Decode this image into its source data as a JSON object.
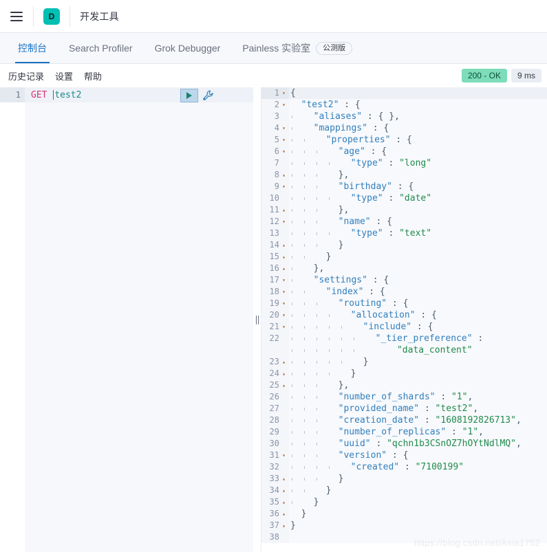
{
  "chrome": {
    "menu_icon": "hamburger-icon",
    "logo_letter": "D",
    "title": "开发工具"
  },
  "tabs": [
    {
      "label": "控制台",
      "active": true
    },
    {
      "label": "Search Profiler",
      "active": false
    },
    {
      "label": "Grok Debugger",
      "active": false
    },
    {
      "label": "Painless 实验室",
      "active": false,
      "badge": "公测版"
    }
  ],
  "console_menu": [
    {
      "label": "历史记录"
    },
    {
      "label": "设置"
    },
    {
      "label": "帮助"
    }
  ],
  "status": {
    "code_label": "200 - OK",
    "time_label": "9 ms",
    "ok_color": "#7ddcb9",
    "time_color": "#e9edf3"
  },
  "request": {
    "line_number": "1",
    "method": "GET",
    "path": "test2",
    "run_icon": "play-icon",
    "wrench_icon": "wrench-icon"
  },
  "response": {
    "lines": [
      {
        "n": "1",
        "fold": "open",
        "guides": 0,
        "text": "{",
        "hl": true
      },
      {
        "n": "2",
        "fold": "open",
        "guides": 0,
        "text": "  \"test2\" : {"
      },
      {
        "n": "3",
        "fold": "",
        "guides": 1,
        "text": "  \"aliases\" : { },"
      },
      {
        "n": "4",
        "fold": "open",
        "guides": 1,
        "text": "  \"mappings\" : {"
      },
      {
        "n": "5",
        "fold": "open",
        "guides": 2,
        "text": "  \"properties\" : {"
      },
      {
        "n": "6",
        "fold": "open",
        "guides": 3,
        "text": "  \"age\" : {"
      },
      {
        "n": "7",
        "fold": "",
        "guides": 4,
        "text": "  \"type\" : \"long\""
      },
      {
        "n": "8",
        "fold": "close",
        "guides": 3,
        "text": "  },"
      },
      {
        "n": "9",
        "fold": "open",
        "guides": 3,
        "text": "  \"birthday\" : {"
      },
      {
        "n": "10",
        "fold": "",
        "guides": 4,
        "text": "  \"type\" : \"date\""
      },
      {
        "n": "11",
        "fold": "close",
        "guides": 3,
        "text": "  },"
      },
      {
        "n": "12",
        "fold": "open",
        "guides": 3,
        "text": "  \"name\" : {"
      },
      {
        "n": "13",
        "fold": "",
        "guides": 4,
        "text": "  \"type\" : \"text\""
      },
      {
        "n": "14",
        "fold": "close",
        "guides": 3,
        "text": "  }"
      },
      {
        "n": "15",
        "fold": "close",
        "guides": 2,
        "text": "  }"
      },
      {
        "n": "16",
        "fold": "close",
        "guides": 1,
        "text": "  },"
      },
      {
        "n": "17",
        "fold": "open",
        "guides": 1,
        "text": "  \"settings\" : {"
      },
      {
        "n": "18",
        "fold": "open",
        "guides": 2,
        "text": "  \"index\" : {"
      },
      {
        "n": "19",
        "fold": "open",
        "guides": 3,
        "text": "  \"routing\" : {"
      },
      {
        "n": "20",
        "fold": "open",
        "guides": 4,
        "text": "  \"allocation\" : {"
      },
      {
        "n": "21",
        "fold": "open",
        "guides": 5,
        "text": "  \"include\" : {"
      },
      {
        "n": "22",
        "fold": "",
        "guides": 6,
        "text": "  \"_tier_preference\" :"
      },
      {
        "n": "",
        "fold": "",
        "guides": 6,
        "text": "      \"data_content\""
      },
      {
        "n": "23",
        "fold": "close",
        "guides": 5,
        "text": "  }"
      },
      {
        "n": "24",
        "fold": "close",
        "guides": 4,
        "text": "  }"
      },
      {
        "n": "25",
        "fold": "close",
        "guides": 3,
        "text": "  },"
      },
      {
        "n": "26",
        "fold": "",
        "guides": 3,
        "text": "  \"number_of_shards\" : \"1\","
      },
      {
        "n": "27",
        "fold": "",
        "guides": 3,
        "text": "  \"provided_name\" : \"test2\","
      },
      {
        "n": "28",
        "fold": "",
        "guides": 3,
        "text": "  \"creation_date\" : \"1608192826713\","
      },
      {
        "n": "29",
        "fold": "",
        "guides": 3,
        "text": "  \"number_of_replicas\" : \"1\","
      },
      {
        "n": "30",
        "fold": "",
        "guides": 3,
        "text": "  \"uuid\" : \"qchn1b3CSnOZ7hOYtNdlMQ\","
      },
      {
        "n": "31",
        "fold": "open",
        "guides": 3,
        "text": "  \"version\" : {"
      },
      {
        "n": "32",
        "fold": "",
        "guides": 4,
        "text": "  \"created\" : \"7100199\""
      },
      {
        "n": "33",
        "fold": "close",
        "guides": 3,
        "text": "  }"
      },
      {
        "n": "34",
        "fold": "close",
        "guides": 2,
        "text": "  }"
      },
      {
        "n": "35",
        "fold": "close",
        "guides": 1,
        "text": "  }"
      },
      {
        "n": "36",
        "fold": "close",
        "guides": 0,
        "text": "  }"
      },
      {
        "n": "37",
        "fold": "close",
        "guides": 0,
        "text": "}"
      },
      {
        "n": "38",
        "fold": "",
        "guides": 0,
        "text": ""
      }
    ]
  },
  "watermark": "https://blog.csdn.net/Asia1752"
}
